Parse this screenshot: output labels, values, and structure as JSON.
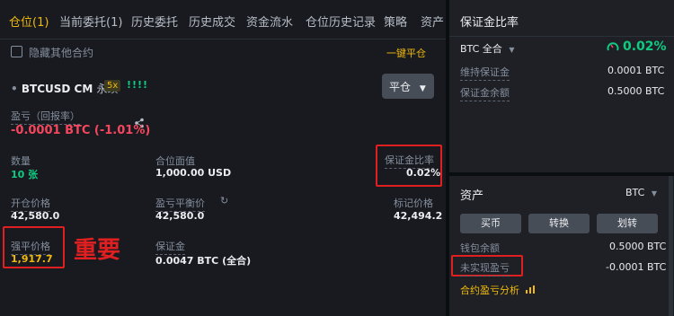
{
  "tabs": [
    {
      "label": "仓位(1)",
      "active": true
    },
    {
      "label": "当前委托(1)"
    },
    {
      "label": "历史委托"
    },
    {
      "label": "历史成交"
    },
    {
      "label": "资金流水"
    },
    {
      "label": "仓位历史记录"
    },
    {
      "label": "策略"
    },
    {
      "label": "资产"
    }
  ],
  "hide_other": "隐藏其他合约",
  "close_all": "一键平仓",
  "position": {
    "symbol": "BTCUSD CM",
    "type": "永续",
    "leverage": "5x",
    "signal": "!!!!",
    "close_button": "平仓",
    "pnl_label": "盈亏（回报率）",
    "pnl_value": "-0.0001 BTC (-1.01%)",
    "quantity_label": "数量",
    "quantity_value": "10 张",
    "position_value_label": "合位面值",
    "position_value": "1,000.00 USD",
    "margin_ratio_label": "保证金比率",
    "margin_ratio_value": "0.02%",
    "entry_price_label": "开仓价格",
    "entry_price_value": "42,580.0",
    "breakeven_label": "盈亏平衡价",
    "breakeven_value": "42,580.0",
    "mark_price_label": "标记价格",
    "mark_price_value": "42,494.2",
    "liq_price_label": "强平价格",
    "liq_price_value": "1,917.7",
    "margin_label": "保证金",
    "margin_value": "0.0047 BTC (全合)"
  },
  "annotation": "重要",
  "right_panel": {
    "title": "保证金比率",
    "asset_mode": "BTC 全合",
    "ratio": "0.02%",
    "maint_margin_label": "维持保证金",
    "maint_margin_value": "0.0001 BTC",
    "margin_balance_label": "保证金余额",
    "margin_balance_value": "0.5000 BTC",
    "assets_title": "资产",
    "asset_select": "BTC",
    "buy_btn": "买币",
    "convert_btn": "转换",
    "transfer_btn": "划转",
    "wallet_label": "钱包余额",
    "wallet_value": "0.5000 BTC",
    "unrealized_label": "未实现盈亏",
    "unrealized_value": "-0.0001 BTC",
    "analysis_link": "合约盈亏分析"
  },
  "colors": {
    "accent": "#f0b90b",
    "loss": "#f6465d",
    "profit": "#0ecb81",
    "annotation": "#e02020"
  }
}
